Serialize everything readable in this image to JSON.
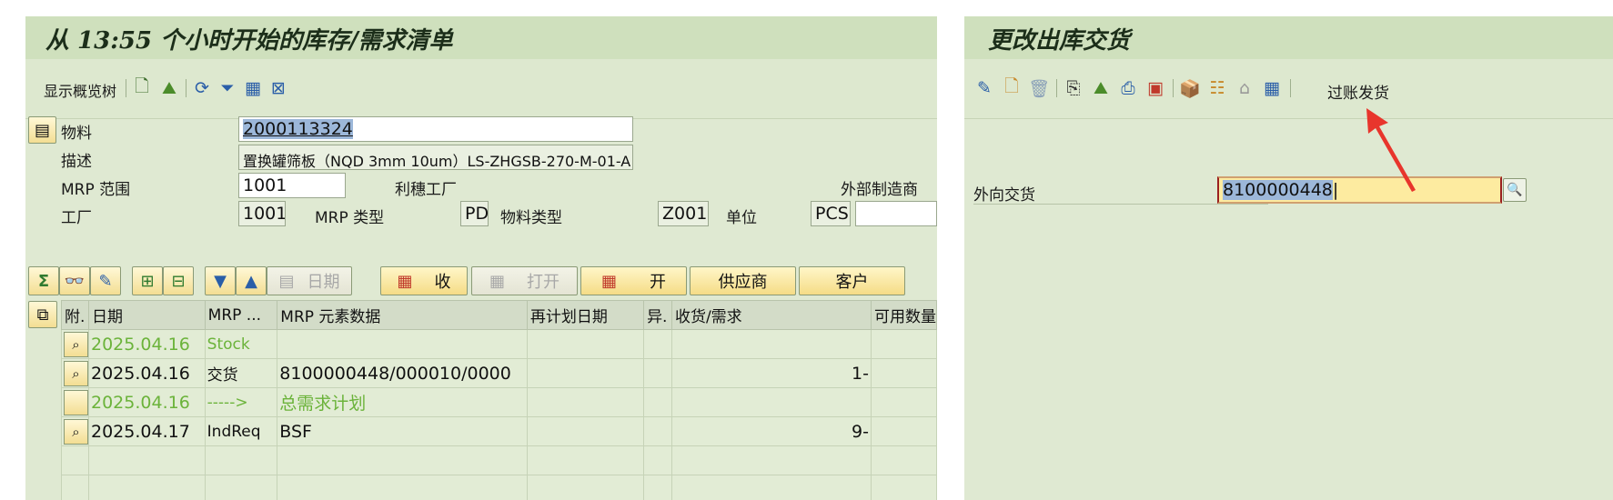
{
  "left": {
    "title": "从 13:55 个小时开始的库存/需求清单",
    "toolbar": {
      "show_tree": "显示概览树",
      "icons": [
        "new-doc-icon",
        "landscape-icon",
        "refresh-icon",
        "filter-icon",
        "tree-icon",
        "excel-icon"
      ]
    },
    "header": {
      "material_label": "物料",
      "material_value": "2000113324",
      "desc_label": "描述",
      "desc_value": "置换罐筛板（NQD 3mm 10um）LS-ZHGSB-270-M-01-A",
      "mrp_area_label": "MRP 范围",
      "mrp_area_value": "1001",
      "mrp_area_text": "利穗工厂",
      "ext_mfr_label": "外部制造商",
      "plant_label": "工厂",
      "plant_value": "1001",
      "mrp_type_label": "MRP 类型",
      "mrp_type_value": "PD",
      "mat_type_label": "物料类型",
      "mat_type_value": "Z001",
      "unit_label": "单位",
      "unit_value": "PCS"
    },
    "buttons": {
      "date": "日期",
      "receive": "收",
      "open_disabled": "打开",
      "open": "开",
      "supplier": "供应商",
      "customer": "客户"
    },
    "table": {
      "columns": [
        "附.",
        "日期",
        "MRP ...",
        "MRP 元素数据",
        "再计划日期",
        "异.",
        "收货/需求",
        "可用数量"
      ],
      "rows": [
        {
          "date": "2025.04.16",
          "mrp": "Stock",
          "data": "",
          "qty": "",
          "style": "green"
        },
        {
          "date": "2025.04.16",
          "mrp": "交货",
          "data": "8100000448/000010/0000",
          "qty": "1-",
          "style": "normal"
        },
        {
          "date": "2025.04.16",
          "mrp": "----->",
          "data": "总需求计划",
          "qty": "",
          "style": "green"
        },
        {
          "date": "2025.04.17",
          "mrp": "IndReq",
          "data": "BSF",
          "qty": "9-",
          "style": "normal"
        }
      ]
    }
  },
  "right": {
    "title": "更改出库交货",
    "toolbar": {
      "post_goods_issue": "过账发货",
      "icons": [
        "glasses-icon",
        "new-doc-icon",
        "trash-icon",
        "copy-icon",
        "landscape-icon",
        "print-icon",
        "block-icon",
        "package-icon",
        "hierarchy-icon",
        "house-icon",
        "grid-icon"
      ]
    },
    "outbound_label": "外向交货",
    "outbound_value": "8100000448"
  },
  "colors": {
    "panel": "#dfe9d2",
    "title": "#cfe0bd",
    "arrow": "#e8352c",
    "highlight": "#fdeba0"
  }
}
